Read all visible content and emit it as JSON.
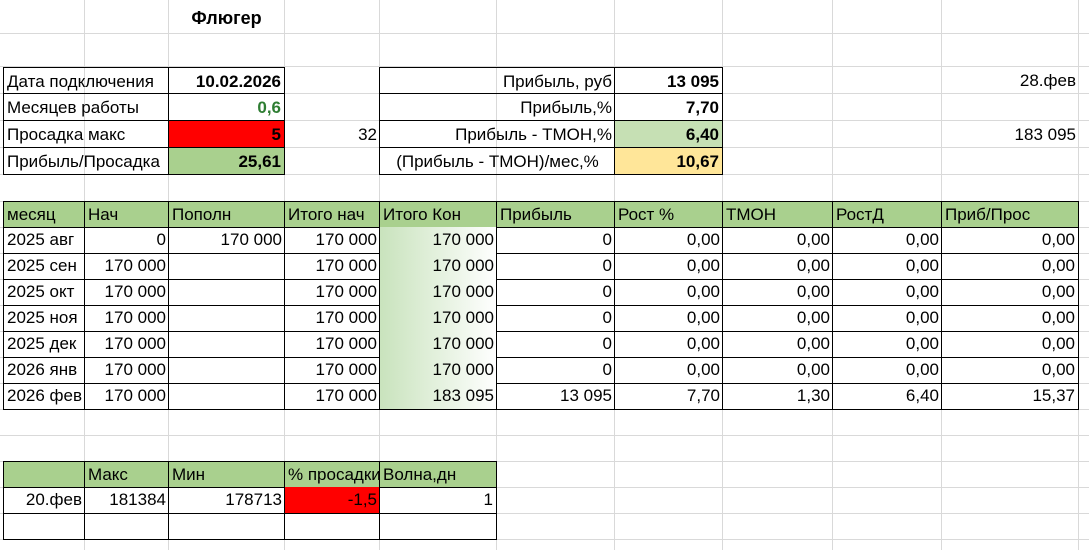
{
  "sheet_title": "Флюгер",
  "info_left": [
    {
      "label": "Дата подключения",
      "value": "10.02.2026"
    },
    {
      "label": "Месяцев работы",
      "value": "0,6"
    },
    {
      "label": "Просадка макс",
      "value": "5"
    },
    {
      "label": "Прибыль/Просадка",
      "value": "25,61"
    }
  ],
  "aside_value_32": "32",
  "info_right": [
    {
      "label": "Прибыль, руб",
      "value": "13 095"
    },
    {
      "label": "Прибыль,%",
      "value": "7,70"
    },
    {
      "label": "Прибыль - ТМОН,%",
      "value": "6,40"
    },
    {
      "label": "(Прибыль - ТМОН)/мес,%",
      "value": "10,67"
    }
  ],
  "far_right": {
    "date": "28.фев",
    "amount": "183 095"
  },
  "main_table": {
    "headers": [
      "месяц",
      "Нач",
      "Пополн",
      "Итого нач",
      "Итого Кон",
      "Прибыль",
      "Рост %",
      "ТМОН",
      "РостД",
      "Приб/Прос"
    ],
    "rows": [
      [
        "2025 авг",
        "0",
        "170 000",
        "170 000",
        "170 000",
        "0",
        "0,00",
        "0,00",
        "0,00",
        "0,00"
      ],
      [
        "2025 сен",
        "170 000",
        "",
        "170 000",
        "170 000",
        "0",
        "0,00",
        "0,00",
        "0,00",
        "0,00"
      ],
      [
        "2025 окт",
        "170 000",
        "",
        "170 000",
        "170 000",
        "0",
        "0,00",
        "0,00",
        "0,00",
        "0,00"
      ],
      [
        "2025 ноя",
        "170 000",
        "",
        "170 000",
        "170 000",
        "0",
        "0,00",
        "0,00",
        "0,00",
        "0,00"
      ],
      [
        "2025 дек",
        "170 000",
        "",
        "170 000",
        "170 000",
        "0",
        "0,00",
        "0,00",
        "0,00",
        "0,00"
      ],
      [
        "2026 янв",
        "170 000",
        "",
        "170 000",
        "170 000",
        "0",
        "0,00",
        "0,00",
        "0,00",
        "0,00"
      ],
      [
        "2026 фев",
        "170 000",
        "",
        "170 000",
        "183 095",
        "13 095",
        "7,70",
        "1,30",
        "6,40",
        "15,37"
      ]
    ]
  },
  "drawdown_table": {
    "headers": [
      "",
      "Макс",
      "Мин",
      "% просадки",
      "Волна,дн"
    ],
    "rows": [
      [
        "20.фев",
        "181384",
        "178713",
        "-1,5",
        "1"
      ]
    ]
  }
}
